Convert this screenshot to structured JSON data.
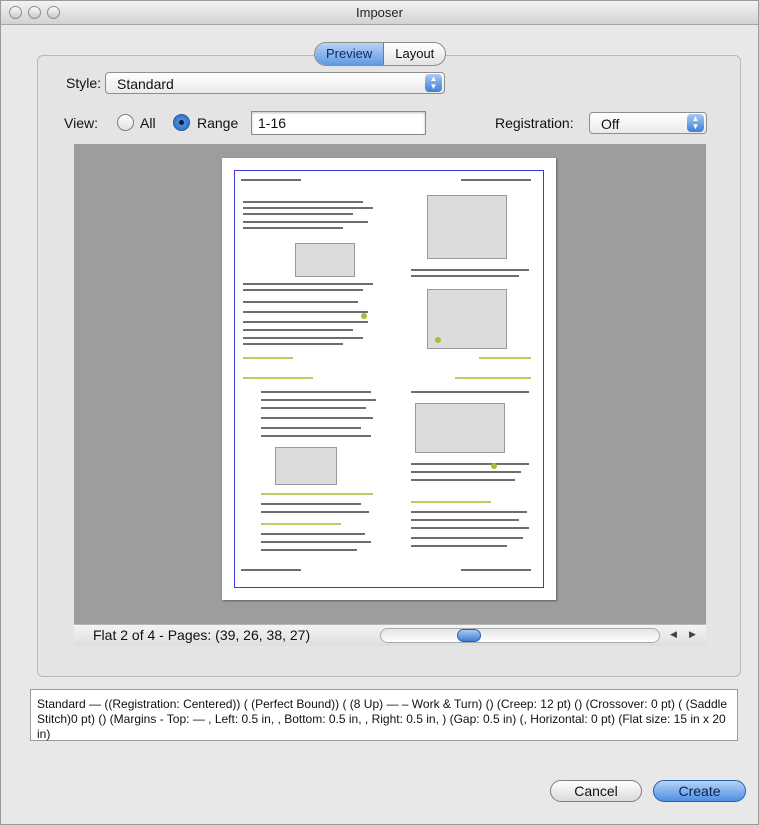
{
  "window": {
    "title": "Imposer"
  },
  "tabs": [
    {
      "label": "Preview",
      "active": true
    },
    {
      "label": "Layout",
      "active": false
    }
  ],
  "style": {
    "label": "Style:",
    "value": "Standard"
  },
  "view": {
    "label": "View:",
    "options": [
      {
        "label": "All",
        "checked": false
      },
      {
        "label": "Range",
        "checked": true
      }
    ],
    "range_value": "1-16"
  },
  "registration": {
    "label": "Registration:",
    "value": "Off"
  },
  "status": {
    "text": "Flat 2 of 4 - Pages: (39, 26, 38, 27)"
  },
  "scroller": {
    "position_fraction": 0.3
  },
  "summary": {
    "text": "Standard — ((Registration: Centered)) ( (Perfect Bound)) ( (8 Up) —  – Work & Turn) () (Creep: 12 pt) () (Crossover: 0 pt) ( (Saddle Stitch)0 pt) () (Margins - Top:  — , Left: 0.5 in, , Bottom: 0.5 in, , Right: 0.5 in, ) (Gap: 0.5 in) (, Horizontal: 0 pt) (Flat size: 15 in x 20 in)"
  },
  "buttons": {
    "cancel": "Cancel",
    "create": "Create"
  },
  "colors": {
    "accent": "#4e8fe2",
    "page_frame": "#3b3bdc",
    "preview_bg": "#9d9d9d"
  },
  "icons": {
    "close": "close-button-icon",
    "minimize": "minimize-button-icon",
    "zoom": "zoom-button-icon",
    "stepper": "updown-chevron-icon",
    "left_arrow": "left-arrow-icon",
    "right_arrow": "right-arrow-icon"
  }
}
